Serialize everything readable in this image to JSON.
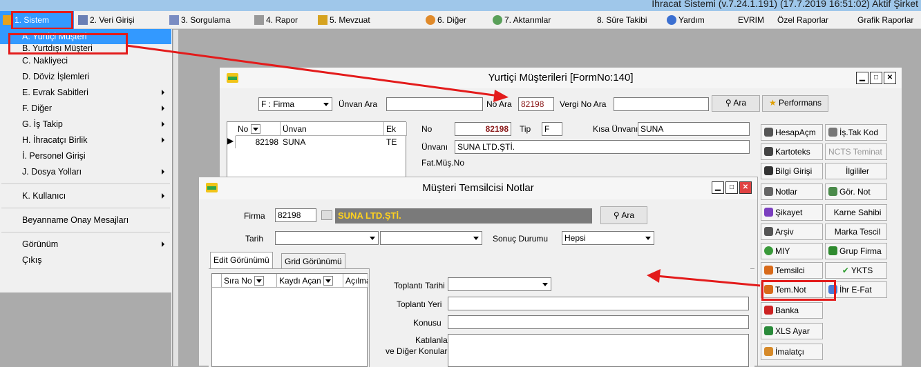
{
  "app_title": "İhracat Sistemi (v.7.24.1.191) (17.7.2019 16:51:02) Aktif Şirket",
  "menu": {
    "sistem": "1. Sistem",
    "veri": "2. Veri Girişi",
    "sorgulama": "3. Sorgulama",
    "rapor": "4. Rapor",
    "mevzuat": "5. Mevzuat",
    "diger": "6. Diğer",
    "aktarimlar": "7. Aktarımlar",
    "sure": "8. Süre Takibi",
    "yardim": "Yardım",
    "evrim": "EVRIM",
    "ozel": "Özel Raporlar",
    "grafik": "Grafik Raporlar"
  },
  "dropdown": {
    "items": [
      "A.  Yurtiçi Müşteri",
      "B.  Yurtdışı Müşteri",
      "C.  Nakliyeci",
      "D.  Döviz İşlemleri",
      "E.  Evrak Sabitleri",
      "F.  Diğer",
      "G.  İş Takip",
      "H.  İhracatçı Birlik",
      "İ.  Personel Girişi",
      "J.  Dosya Yolları",
      "K.  Kullanıcı",
      "Beyanname Onay Mesajları",
      "Görünüm",
      "Çıkış"
    ]
  },
  "w1": {
    "title": "Yurtiçi Müşterileri [FormNo:140]",
    "filter_value": "F : Firma",
    "unvan_ara": "Ünvan Ara",
    "no_ara": "No Ara",
    "no_ara_value": "82198",
    "vergi_no_ara": "Vergi No Ara",
    "ara": "Ara",
    "performans": "Performans",
    "grid_cols": [
      "No",
      "Ünvan",
      "Ek"
    ],
    "grid_row": {
      "no": "82198",
      "unvan": "SUNA",
      "ek": "TE"
    },
    "no_label": "No",
    "no_value": "82198",
    "tip_label": "Tip",
    "tip_value": "F",
    "kisa_unvani_label": "Kısa Ünvanı",
    "kisa_unvani_value": "SUNA",
    "unvani_label": "Ünvanı",
    "unvani_value": "SUNA LTD.ŞTİ.",
    "fat_mus_label": "Fat.Müş.No",
    "side_buttons": {
      "hesap": "HesapAçm",
      "istak": "İş.Tak Kod",
      "kartoteks": "Kartoteks",
      "ncts": "NCTS Teminat",
      "bilgi": "Bilgi Girişi",
      "ilgililer": "İlgililer",
      "notlar": "Notlar",
      "gornot": "Gör. Not",
      "sikayet": "Şikayet",
      "karne": "Karne Sahibi",
      "arsiv": "Arşiv",
      "marka": "Marka Tescil",
      "miy": "MIY",
      "grupfirma": "Grup Firma",
      "temsilci": "Temsilci",
      "ykts": "YKTS",
      "temnot": "Tem.Not",
      "ihrefat": "İhr E-Fat",
      "banka": "Banka",
      "xls": "XLS Ayar",
      "imalatci": "İmalatçı"
    }
  },
  "w2": {
    "title": "Müşteri Temsilcisi Notlar",
    "firma_label": "Firma",
    "firma_no": "82198",
    "firma_name": "SUNA LTD.ŞTİ.",
    "ara": "Ara",
    "tarih_label": "Tarih",
    "sonuc_label": "Sonuç Durumu",
    "sonuc_value": "Hepsi",
    "tabs": [
      "Edit Görünümü",
      "Grid Görünümü"
    ],
    "grid_cols": [
      "Sıra No",
      "Kaydı Açan",
      "Açılma"
    ],
    "toplanti_tarihi": "Toplantı Tarihi",
    "toplanti_yeri": "Toplantı Yeri",
    "konusu": "Konusu",
    "katilanlar1": "Katılanlar",
    "katilanlar2": "ve Diğer Konular"
  },
  "colors": {
    "highlight": "#e31b1b",
    "selection": "#3399ff",
    "brand_maroon": "#8b1a1a"
  }
}
